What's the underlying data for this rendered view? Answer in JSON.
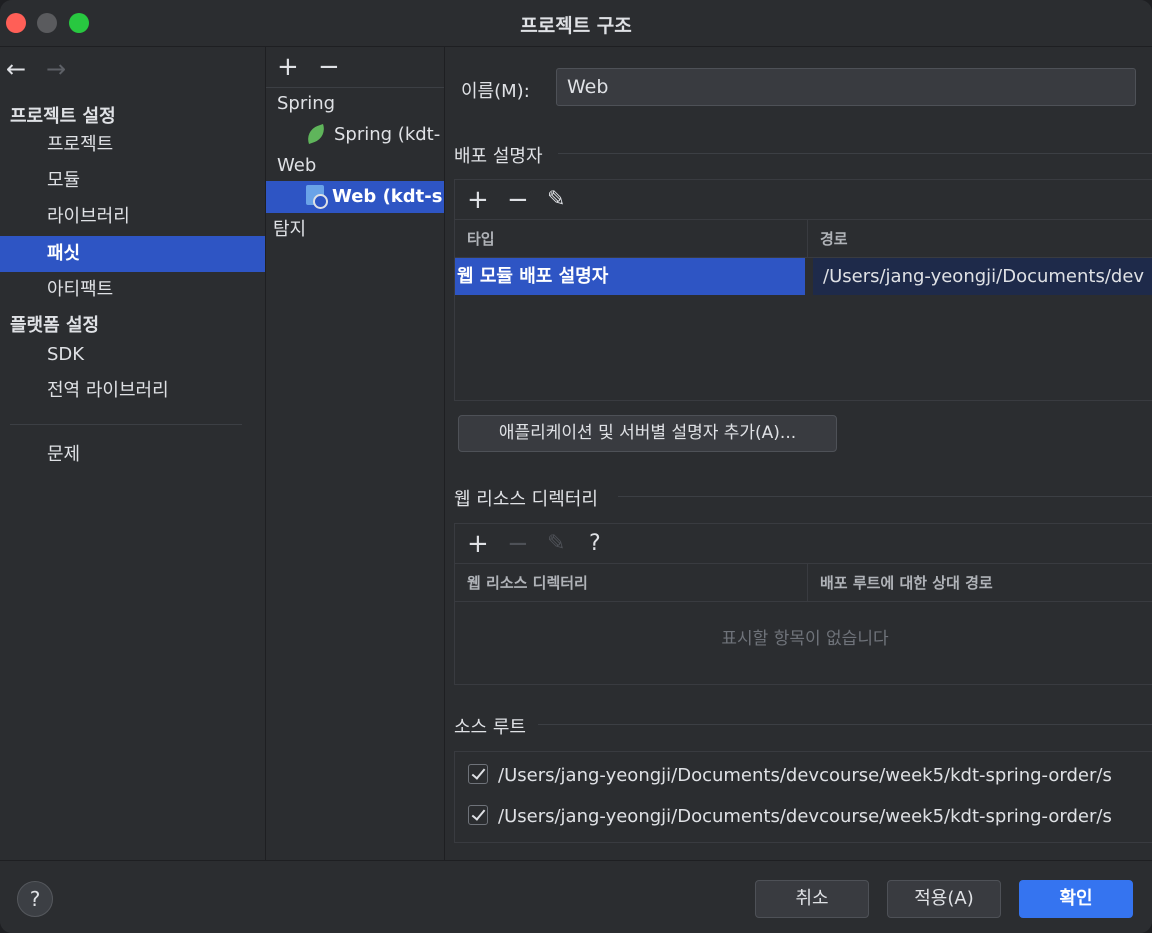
{
  "window": {
    "title": "프로젝트 구조",
    "colors": {
      "close": "#ff5f57",
      "minimize": "#5a5b5e",
      "maximize": "#28c840",
      "accent": "#2e55c4",
      "primary_button": "#3574f0"
    }
  },
  "nav": {
    "back": "←",
    "forward": "→",
    "project_settings_title": "프로젝트 설정",
    "project_items": [
      "프로젝트",
      "모듈",
      "라이브러리",
      "패싯",
      "아티팩트"
    ],
    "platform_settings_title": "플랫폼 설정",
    "platform_items": [
      "SDK",
      "전역 라이브러리"
    ],
    "problems": "문제",
    "selected": "패싯"
  },
  "tree": {
    "add": "+",
    "remove": "−",
    "items": [
      {
        "label": "Spring",
        "icon": "spring-leaf-icon"
      },
      {
        "label": "Spring (kdt-",
        "icon": "spring-leaf-icon"
      },
      {
        "label": "Web",
        "icon": ""
      },
      {
        "label": "Web (kdt-sp",
        "icon": "web-facet-icon"
      },
      {
        "label": "탐지",
        "icon": ""
      }
    ]
  },
  "facet": {
    "name_label": "이름(M):",
    "name_value": "Web",
    "descriptors": {
      "title": "배포 설명자",
      "tools": [
        "+",
        "−",
        "✎"
      ],
      "columns": [
        "타입",
        "경로"
      ],
      "rows": [
        {
          "type": "웹 모듈 배포 설명자",
          "path": "/Users/jang-yeongji/Documents/dev"
        }
      ],
      "add_button": "애플리케이션 및 서버별 설명자 추가(A)..."
    },
    "web_resources": {
      "title": "웹 리소스 디렉터리",
      "tools": [
        "+",
        "−",
        "✎",
        "?"
      ],
      "columns": [
        "웹 리소스 디렉터리",
        "배포 루트에 대한 상대 경로"
      ],
      "empty": "표시할 항목이 없습니다"
    },
    "source_roots": {
      "title": "소스 루트",
      "items": [
        "/Users/jang-yeongji/Documents/devcourse/week5/kdt-spring-order/s",
        "/Users/jang-yeongji/Documents/devcourse/week5/kdt-spring-order/s"
      ]
    }
  },
  "footer": {
    "help": "?",
    "cancel": "취소",
    "apply": "적용(A)",
    "ok": "확인"
  }
}
